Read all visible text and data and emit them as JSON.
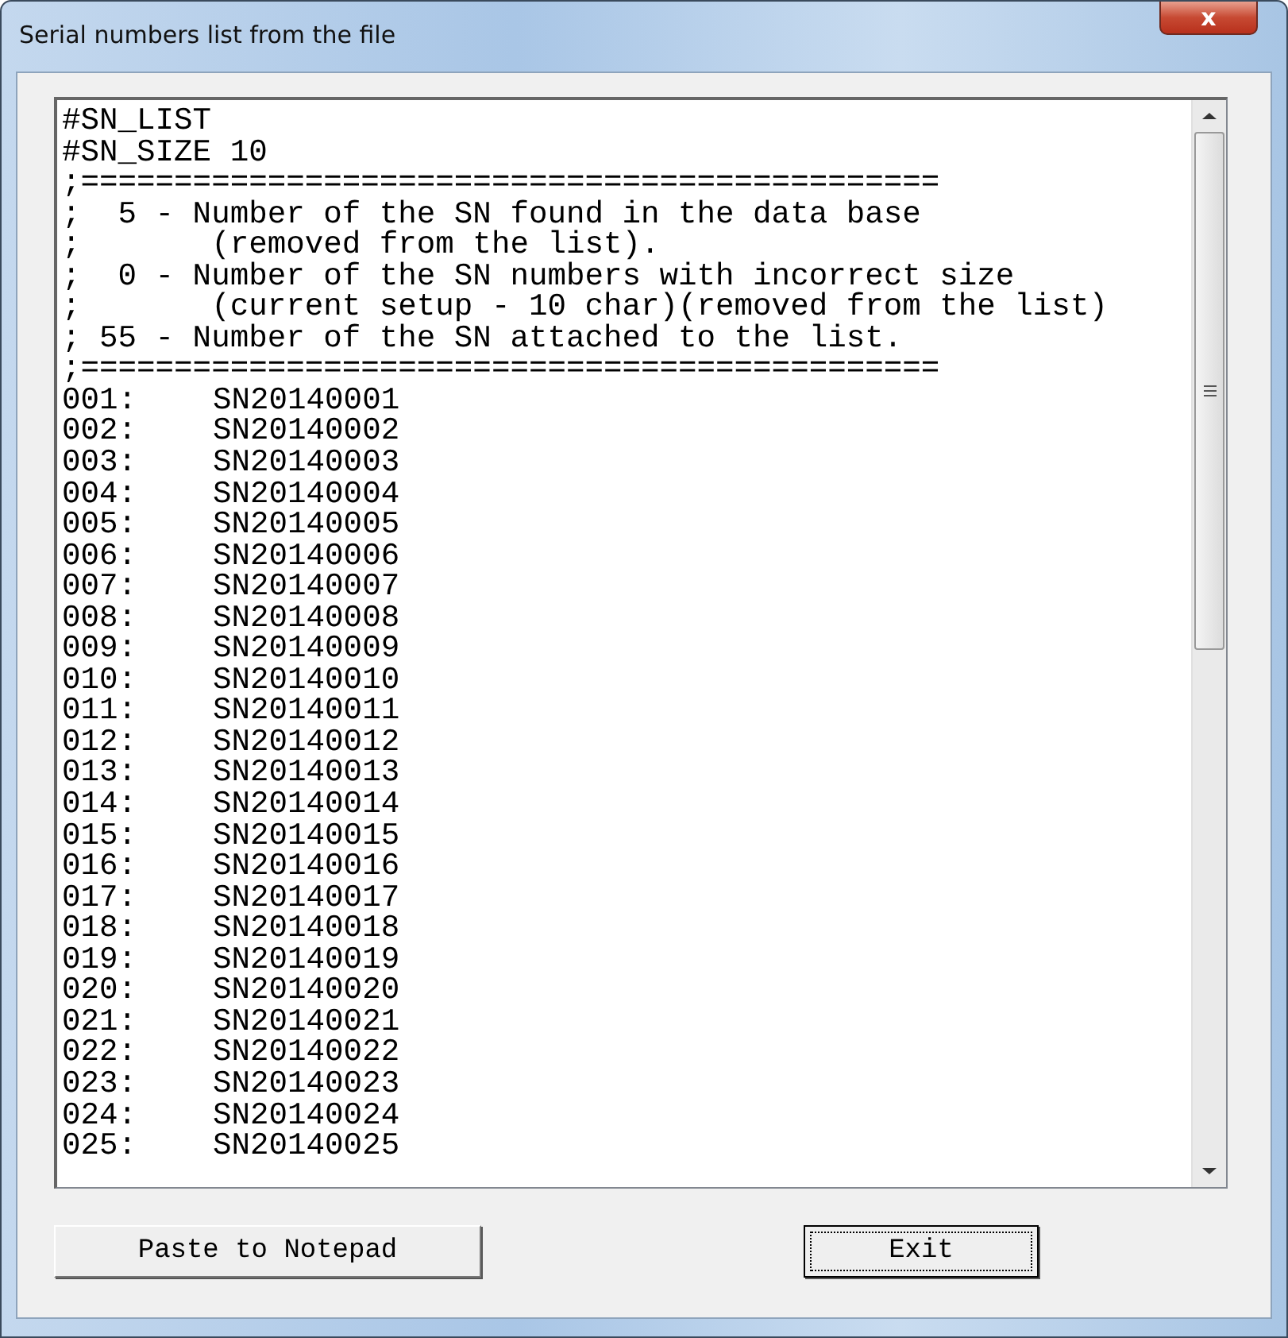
{
  "window": {
    "title": "Serial numbers list from the file",
    "close": "x"
  },
  "text_area": {
    "header_lines": [
      "#SN_LIST",
      "#SN_SIZE 10",
      ";==============================================",
      ";  5 - Number of the SN found in the data base",
      ";       (removed from the list).",
      ";  0 - Number of the SN numbers with incorrect size",
      ";       (current setup - 10 char)(removed from the list)",
      "; 55 - Number of the SN attached to the list.",
      ";=============================================="
    ],
    "entries": [
      {
        "number": "001:",
        "serial": "SN20140001"
      },
      {
        "number": "002:",
        "serial": "SN20140002"
      },
      {
        "number": "003:",
        "serial": "SN20140003"
      },
      {
        "number": "004:",
        "serial": "SN20140004"
      },
      {
        "number": "005:",
        "serial": "SN20140005"
      },
      {
        "number": "006:",
        "serial": "SN20140006"
      },
      {
        "number": "007:",
        "serial": "SN20140007"
      },
      {
        "number": "008:",
        "serial": "SN20140008"
      },
      {
        "number": "009:",
        "serial": "SN20140009"
      },
      {
        "number": "010:",
        "serial": "SN20140010"
      },
      {
        "number": "011:",
        "serial": "SN20140011"
      },
      {
        "number": "012:",
        "serial": "SN20140012"
      },
      {
        "number": "013:",
        "serial": "SN20140013"
      },
      {
        "number": "014:",
        "serial": "SN20140014"
      },
      {
        "number": "015:",
        "serial": "SN20140015"
      },
      {
        "number": "016:",
        "serial": "SN20140016"
      },
      {
        "number": "017:",
        "serial": "SN20140017"
      },
      {
        "number": "018:",
        "serial": "SN20140018"
      },
      {
        "number": "019:",
        "serial": "SN20140019"
      },
      {
        "number": "020:",
        "serial": "SN20140020"
      },
      {
        "number": "021:",
        "serial": "SN20140021"
      },
      {
        "number": "022:",
        "serial": "SN20140022"
      },
      {
        "number": "023:",
        "serial": "SN20140023"
      },
      {
        "number": "024:",
        "serial": "SN20140024"
      },
      {
        "number": "025:",
        "serial": "SN20140025"
      }
    ]
  },
  "buttons": [
    {
      "label": "Paste to Notepad",
      "selected": false
    },
    {
      "label": "Exit",
      "selected": true
    }
  ]
}
